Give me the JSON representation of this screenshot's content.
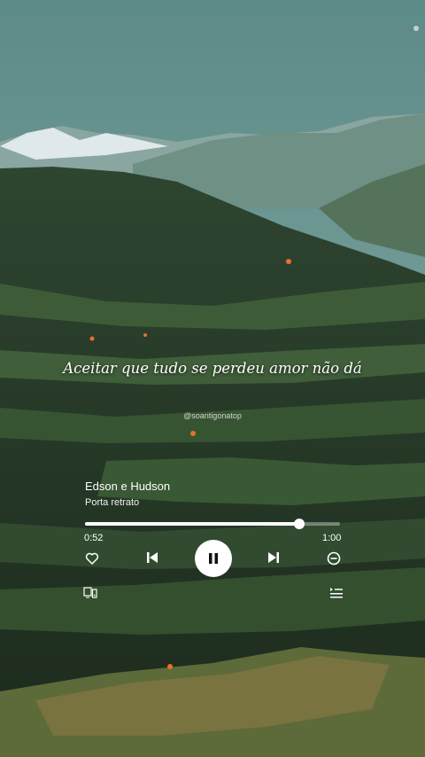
{
  "lyric_line": "Aceitar que tudo se perdeu amor não dá",
  "watermark": "@soantigonatop",
  "player": {
    "artist": "Edson e Hudson",
    "track": "Porta retrato",
    "elapsed": "0:52",
    "total": "1:00",
    "progress_fraction": 0.84,
    "icons": {
      "like": "heart-outline-icon",
      "previous": "skip-previous-icon",
      "play_pause": "pause-icon",
      "next": "skip-next-icon",
      "remove": "minus-circle-icon",
      "devices": "devices-icon",
      "queue": "queue-list-icon"
    }
  }
}
